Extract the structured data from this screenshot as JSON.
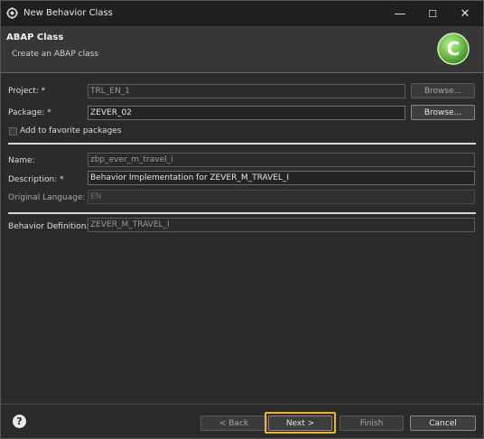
{
  "window": {
    "title": "New Behavior Class",
    "minimize": "—",
    "maximize": "☐",
    "close": "✕"
  },
  "banner": {
    "title": "ABAP Class",
    "subtitle": "Create an ABAP class",
    "logo_letter": "C"
  },
  "form": {
    "project_label": "Project: *",
    "project_value": "TRL_EN_1",
    "package_label": "Package: *",
    "package_value": "ZEVER_02",
    "browse_label": "Browse...",
    "favorite_label": "Add to favorite packages",
    "name_label": "Name:",
    "name_value": "zbp_ever_m_travel_i",
    "description_label": "Description: *",
    "description_value": "Behavior Implementation for ZEVER_M_TRAVEL_I",
    "language_label": "Original Language:",
    "language_value": "EN",
    "behavior_label": "Behavior Definition:",
    "behavior_value": "ZEVER_M_TRAVEL_I"
  },
  "footer": {
    "help": "?",
    "back": "< Back",
    "next": "Next >",
    "finish": "Finish",
    "cancel": "Cancel"
  },
  "colors": {
    "background": "#2b2b2b",
    "focus_ring": "#f0b323",
    "logo_green": "#6cc04a"
  }
}
